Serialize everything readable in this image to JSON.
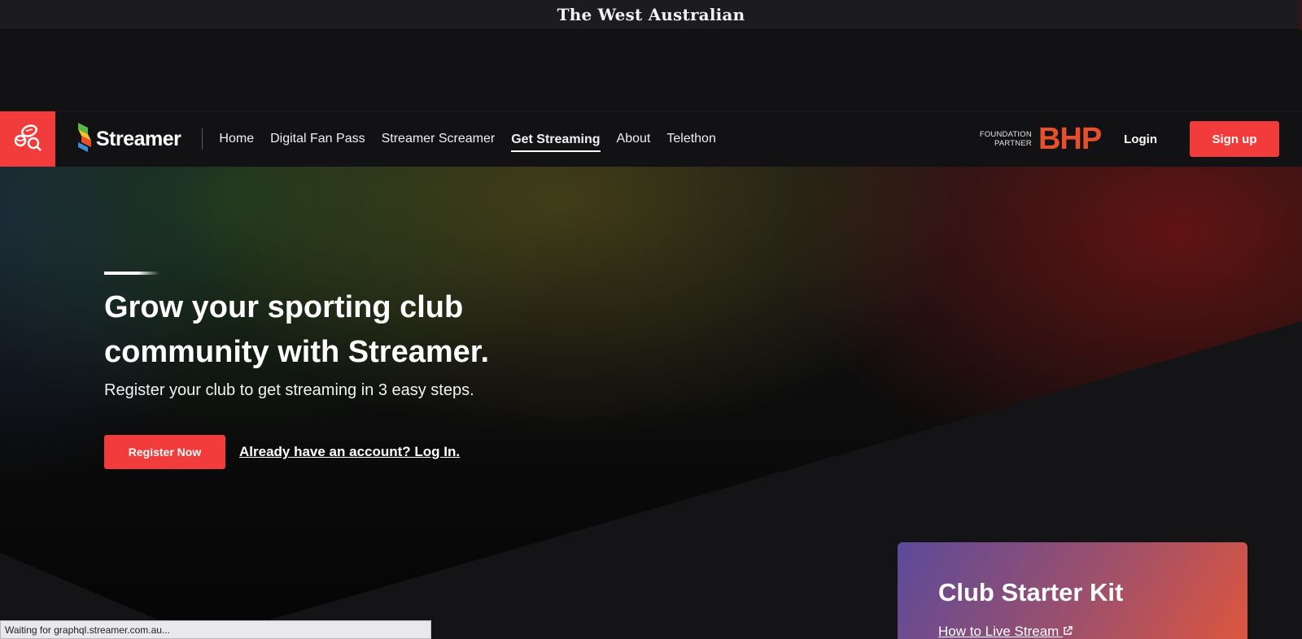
{
  "masthead": {
    "title": "The West Australian"
  },
  "nav": {
    "brand": "Streamer",
    "links": [
      {
        "label": "Home"
      },
      {
        "label": "Digital Fan Pass"
      },
      {
        "label": "Streamer Screamer"
      },
      {
        "label": "Get Streaming"
      },
      {
        "label": "About"
      },
      {
        "label": "Telethon"
      }
    ],
    "active": "Get Streaming",
    "partner_line1": "FOUNDATION",
    "partner_line2": "PARTNER",
    "partner_name": "BHP",
    "login": "Login",
    "signup": "Sign up"
  },
  "hero": {
    "headline": "Grow your sporting club community with Streamer.",
    "subtitle": "Register your club to get streaming in 3 easy steps.",
    "register_button": "Register Now",
    "login_link": "Already have an account? Log In."
  },
  "kit": {
    "title": "Club Starter Kit",
    "link": "How to Live Stream"
  },
  "status": {
    "text": "Waiting for graphql.streamer.com.au..."
  },
  "colors": {
    "accent": "#f23b3b",
    "partner": "#e8502b",
    "background": "#141417"
  }
}
